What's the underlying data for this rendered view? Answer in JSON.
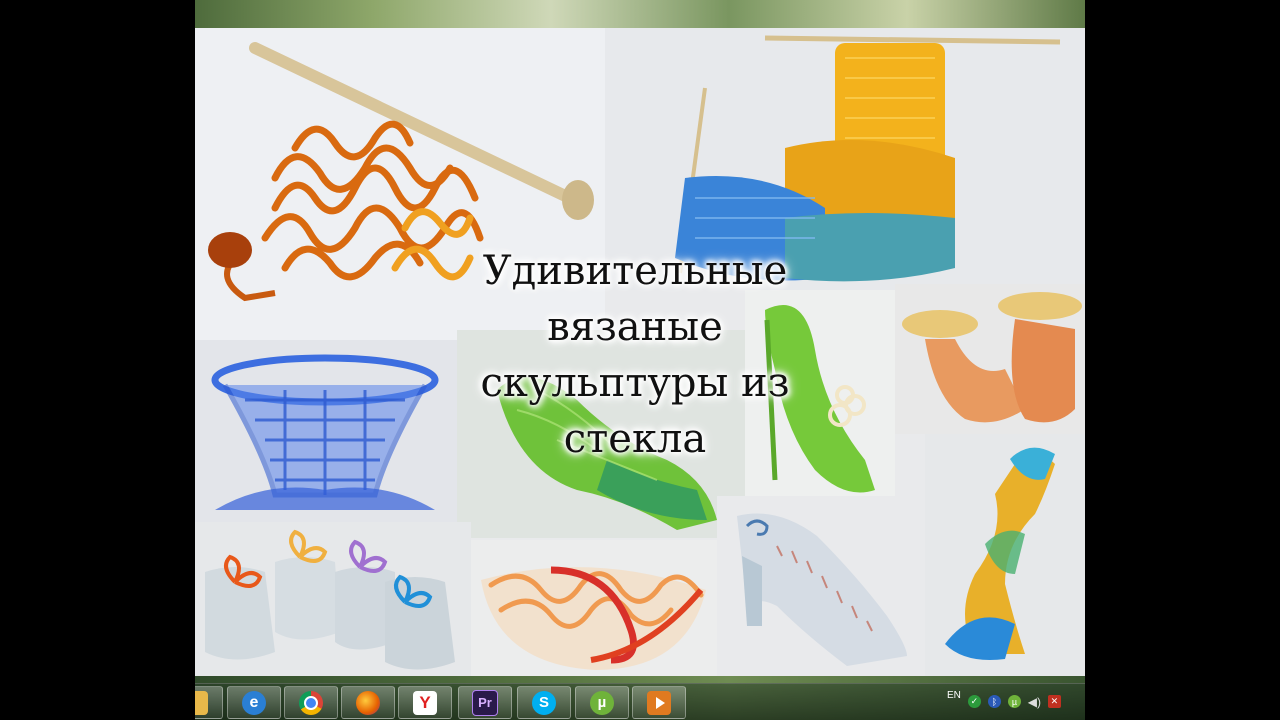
{
  "slide": {
    "title_lines": [
      "Удивительные",
      "вязаные",
      "скульптуры из",
      "стекла"
    ]
  },
  "taskbar": {
    "buttons": [
      {
        "name": "explorer",
        "icon": "folder-icon",
        "color": "#e8b84a"
      },
      {
        "name": "internet-explorer",
        "icon": "ie-icon",
        "label": "e",
        "color": "#2a7fd4"
      },
      {
        "name": "chrome",
        "icon": "chrome-icon",
        "color": "#db4437"
      },
      {
        "name": "firefox",
        "icon": "firefox-icon",
        "color": "#e66000"
      },
      {
        "name": "yandex",
        "icon": "yandex-icon",
        "label": "Y",
        "color": "#ffffff"
      },
      {
        "name": "premiere",
        "icon": "premiere-icon",
        "label": "Pr",
        "color": "#2a1a4a"
      },
      {
        "name": "skype",
        "icon": "skype-icon",
        "label": "S",
        "color": "#00aff0"
      },
      {
        "name": "utorrent",
        "icon": "utorrent-icon",
        "label": "µ",
        "color": "#6fb33a"
      },
      {
        "name": "media-player",
        "icon": "media-player-icon",
        "color": "#e07a20"
      }
    ],
    "tray": {
      "language": "EN"
    }
  }
}
